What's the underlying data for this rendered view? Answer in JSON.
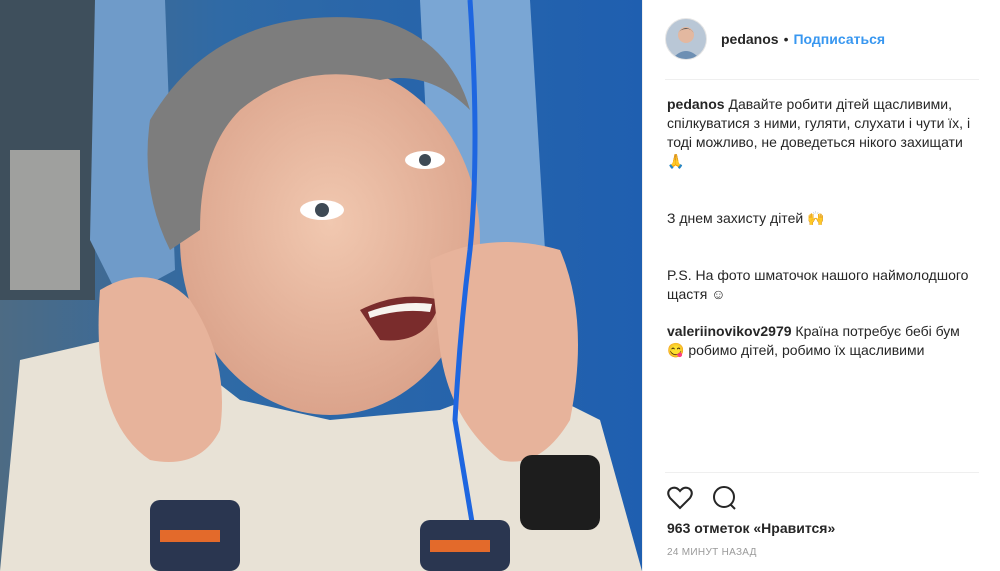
{
  "post": {
    "username": "pedanos",
    "dot": "•",
    "follow_label": "Подписаться"
  },
  "caption": {
    "username": "pedanos",
    "line1": "Давайте робити дітей щасливими, спілкуватися з ними, гуляти, слухати і чути їх, і тоді можливо, не доведеться нікого захищати 🙏",
    "line2": "З днем захисту дітей 🙌",
    "line3": "P.S. На фото шматочок нашого наймолодшого щастя ☺"
  },
  "comment": {
    "username": "valeriinovikov2979",
    "text": "Країна потребує бебі бум 😋 робимо дітей, робимо їх щасливими"
  },
  "likes_text": "963 отметок «Нравится»",
  "time_text": "24 МИНУТ НАЗАД",
  "icons": {
    "like": "heart-icon",
    "comment": "comment-icon"
  },
  "colors": {
    "link": "#3897f0",
    "text": "#262626",
    "muted": "#999999"
  }
}
